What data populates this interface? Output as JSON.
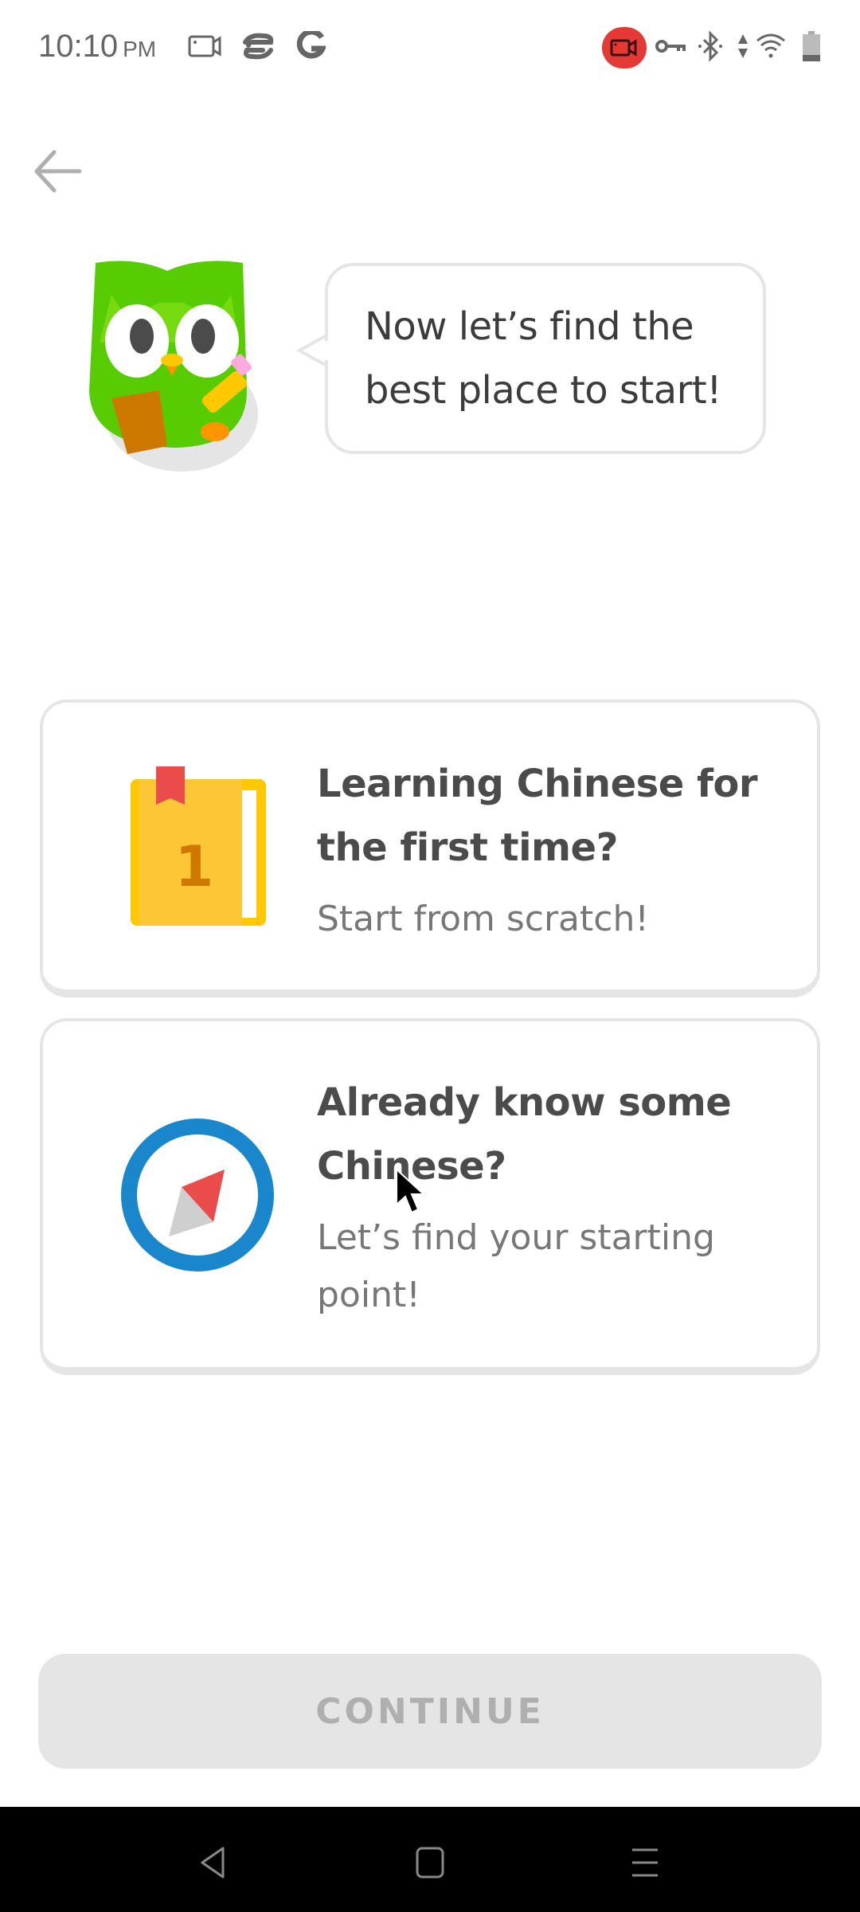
{
  "status_bar": {
    "time": "10:10",
    "ampm": "PM",
    "left_icons": [
      "screen-record-icon",
      "cloud-sync-icon",
      "google-icon"
    ],
    "right_icons": [
      "recording-indicator-icon",
      "vpn-key-icon",
      "bluetooth-icon",
      "data-arrows-icon",
      "wifi-icon",
      "battery-icon"
    ],
    "recording_color": "#e53935"
  },
  "header": {
    "back_icon": "arrow-left-icon"
  },
  "mascot": {
    "speech": "Now let’s find the best place to start!",
    "speech_lines": [
      "Now let’s find the",
      "best place to start!"
    ]
  },
  "options": [
    {
      "icon": "book-icon",
      "icon_number": "1",
      "title_lines": [
        "Learning Chinese for",
        "the first time?"
      ],
      "subtitle_lines": [
        "Start from scratch!"
      ]
    },
    {
      "icon": "compass-icon",
      "title_lines": [
        "Already know some",
        "Chinese?"
      ],
      "subtitle_lines": [
        "Let’s find your starting",
        "point!"
      ]
    }
  ],
  "footer": {
    "continue_label": "CONTINUE",
    "continue_enabled": false
  },
  "nav_bar": {
    "back": "nav-back-icon",
    "home": "nav-home-icon",
    "recents": "nav-recents-icon"
  },
  "colors": {
    "owl_green": "#58cc02",
    "book_yellow": "#ffc800",
    "bookmark_red": "#ea4b4b",
    "compass_blue": "#1a86cc",
    "button_disabled_bg": "#e5e5e5",
    "button_disabled_text": "#afafaf"
  }
}
